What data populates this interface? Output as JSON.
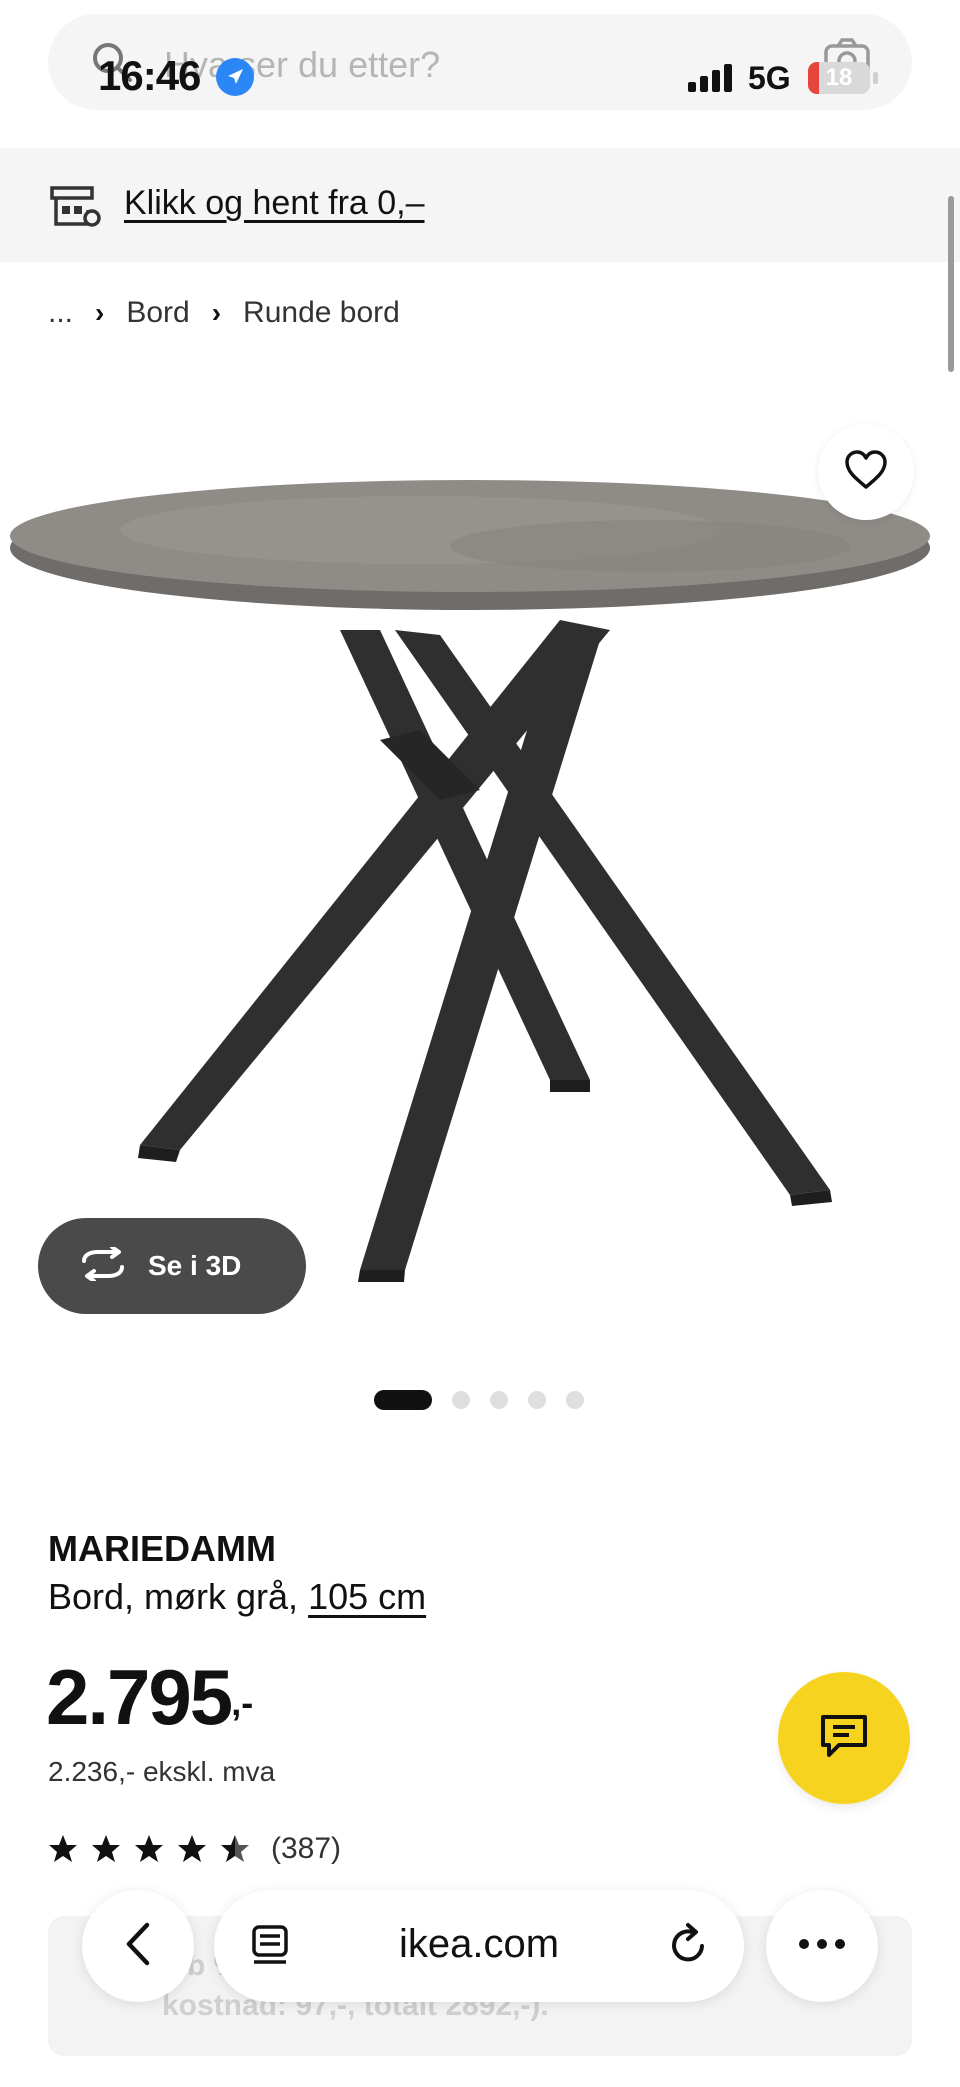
{
  "status_bar": {
    "time": "16:46",
    "network": "5G",
    "battery_level": "18",
    "battery_fraction": 0.18
  },
  "search": {
    "placeholder": "Hva ser du etter?"
  },
  "promo": {
    "link_text": "Klikk og hent fra 0,–"
  },
  "breadcrumb": {
    "items": [
      "...",
      "Bord",
      "Runde bord"
    ]
  },
  "gallery": {
    "view_3d_label": "Se i 3D",
    "slide_count": 5,
    "active_slide": 1
  },
  "product": {
    "name": "MARIEDAMM",
    "description": "Bord, mørk grå,",
    "size_link": "105 cm",
    "price_main": "2.795",
    "price_suffix": ",-",
    "price_ex_vat": "2.236,- ekskl. mva",
    "rating_stars": 4.5,
    "rating_count": "(387)"
  },
  "finance_card": {
    "line1": "    elb                                                 %,",
    "line2": "kostnad: 97,-, totalt 2892,-)."
  },
  "browser": {
    "url": "ikea.com"
  },
  "icons": {
    "search": "search-icon",
    "camera": "camera-icon",
    "store": "store-icon",
    "heart": "heart-icon",
    "rotate": "rotate-3d-icon",
    "chat": "chat-icon",
    "back": "chevron-left-icon",
    "reader": "reader-icon",
    "reload": "reload-icon",
    "more": "more-icon"
  },
  "colors": {
    "accent_yellow": "#f6d31e",
    "dark_button": "#4a4a4a",
    "location_blue": "#2b87f5",
    "battery_red": "#e5453a"
  }
}
